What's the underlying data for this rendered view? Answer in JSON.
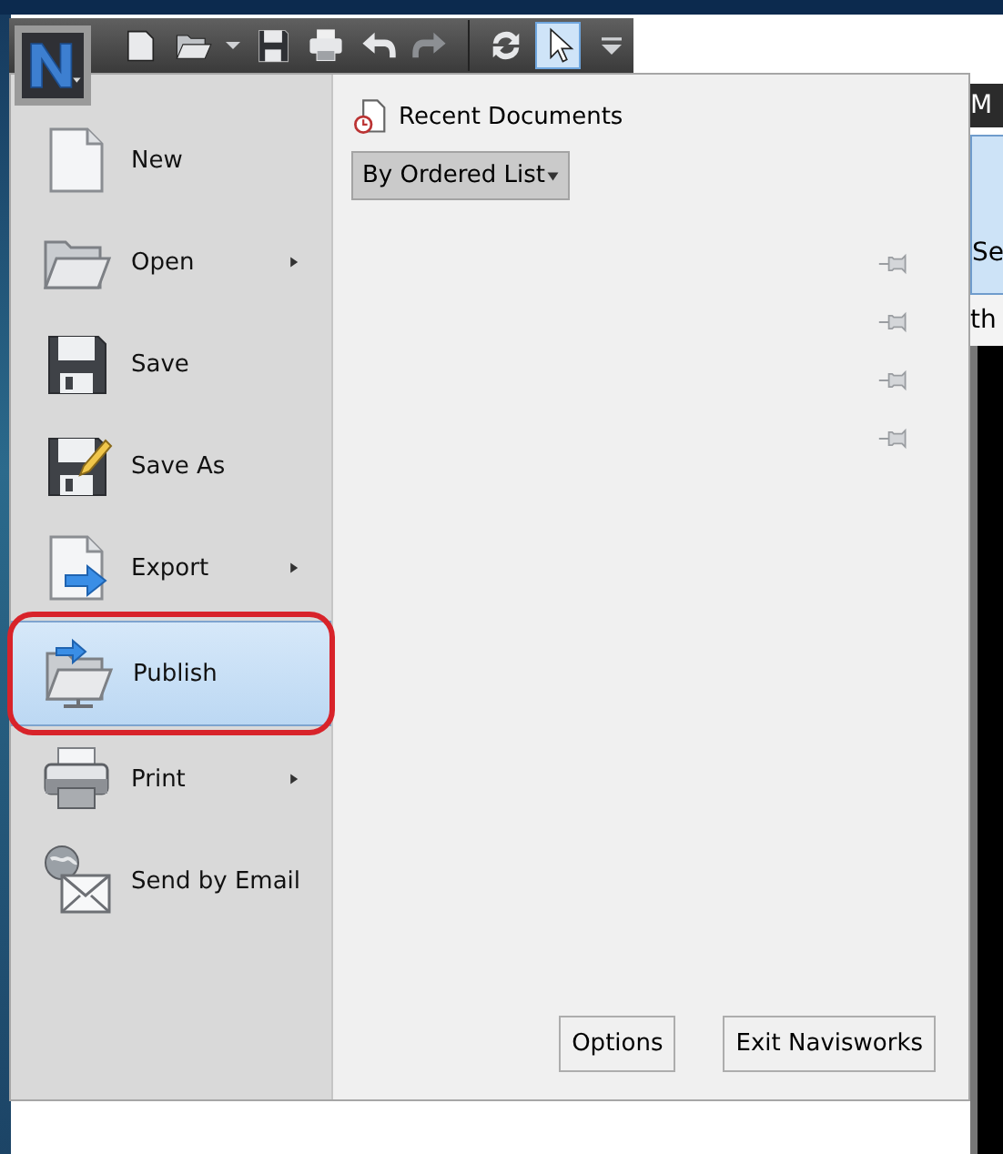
{
  "background_window": {
    "header": "M",
    "tile": "Se",
    "tab": "th"
  },
  "quick_access_toolbar": [
    {
      "kind": "new",
      "selected": false
    },
    {
      "kind": "open",
      "selected": false
    },
    {
      "kind": "dropdown",
      "selected": false
    },
    {
      "kind": "save",
      "selected": false
    },
    {
      "kind": "print",
      "selected": false
    },
    {
      "kind": "undo",
      "selected": false
    },
    {
      "kind": "redo",
      "selected": false
    },
    {
      "kind": "separator"
    },
    {
      "kind": "refresh",
      "selected": false
    },
    {
      "kind": "select",
      "selected": true
    },
    {
      "kind": "customize",
      "selected": false
    }
  ],
  "application_menu": {
    "items": [
      {
        "label": "New",
        "kind": "new",
        "has_submenu": false,
        "selected": false,
        "circled": false
      },
      {
        "label": "Open",
        "kind": "open",
        "has_submenu": true,
        "selected": false,
        "circled": false
      },
      {
        "label": "Save",
        "kind": "save",
        "has_submenu": false,
        "selected": false,
        "circled": false
      },
      {
        "label": "Save As",
        "kind": "saveas",
        "has_submenu": false,
        "selected": false,
        "circled": false
      },
      {
        "label": "Export",
        "kind": "export",
        "has_submenu": true,
        "selected": false,
        "circled": false
      },
      {
        "label": "Publish",
        "kind": "publish",
        "has_submenu": false,
        "selected": true,
        "circled": true
      },
      {
        "label": "Print",
        "kind": "print",
        "has_submenu": true,
        "selected": false,
        "circled": false
      },
      {
        "label": "Send by Email",
        "kind": "email",
        "has_submenu": false,
        "selected": false,
        "circled": false
      }
    ],
    "recent_documents": {
      "title": "Recent Documents",
      "sort": "By Ordered List",
      "entries": [
        {
          "pinned": false
        },
        {
          "pinned": false
        },
        {
          "pinned": false
        },
        {
          "pinned": false
        }
      ]
    },
    "buttons": [
      "Options",
      "Exit Navisworks"
    ]
  }
}
